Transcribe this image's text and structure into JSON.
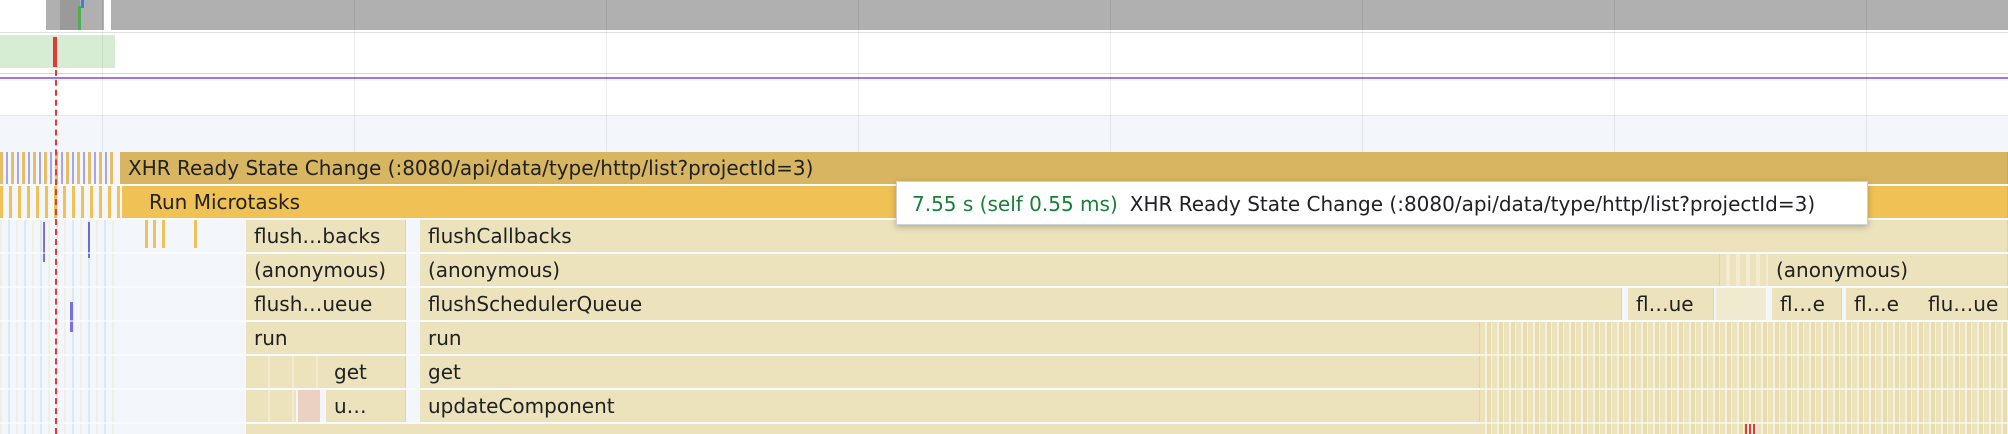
{
  "flame": {
    "rows": [
      {
        "bars": [
          {
            "label": "XHR Ready State Change (:8080/api/data/type/http/list?projectId=3)",
            "color": "#d8b561"
          }
        ]
      },
      {
        "bars": [
          {
            "label": "Run Microtasks",
            "color": "#f0c155"
          }
        ]
      },
      {
        "bars": [
          {
            "label": "flush…backs"
          },
          {
            "label": "flushCallbacks"
          }
        ]
      },
      {
        "bars": [
          {
            "label": "(anonymous)"
          },
          {
            "label": "(anonymous)"
          },
          {
            "label": "(anonymous)"
          }
        ]
      },
      {
        "bars": [
          {
            "label": "flush…ueue"
          },
          {
            "label": "flushSchedulerQueue"
          },
          {
            "label": "fl…ue"
          },
          {
            "label": "fl…e"
          },
          {
            "label": "fl…e"
          },
          {
            "label": "flu…ue"
          }
        ]
      },
      {
        "bars": [
          {
            "label": "run"
          },
          {
            "label": "run"
          }
        ]
      },
      {
        "bars": [
          {
            "label": "get"
          },
          {
            "label": "get"
          }
        ]
      },
      {
        "bars": [
          {
            "label": "u…"
          },
          {
            "label": "updateComponent"
          }
        ]
      }
    ]
  },
  "tooltip": {
    "time": "7.55 s (self 0.55 ms)",
    "name": "XHR Ready State Change (:8080/api/data/type/http/list?projectId=3)"
  },
  "colors": {
    "xhr": "#d8b561",
    "microtasks": "#f0c155",
    "script": "#ece2bb",
    "timeline_marker": "#e53935",
    "network_line": "#9e7ad6",
    "tooltip_time": "#188038"
  }
}
